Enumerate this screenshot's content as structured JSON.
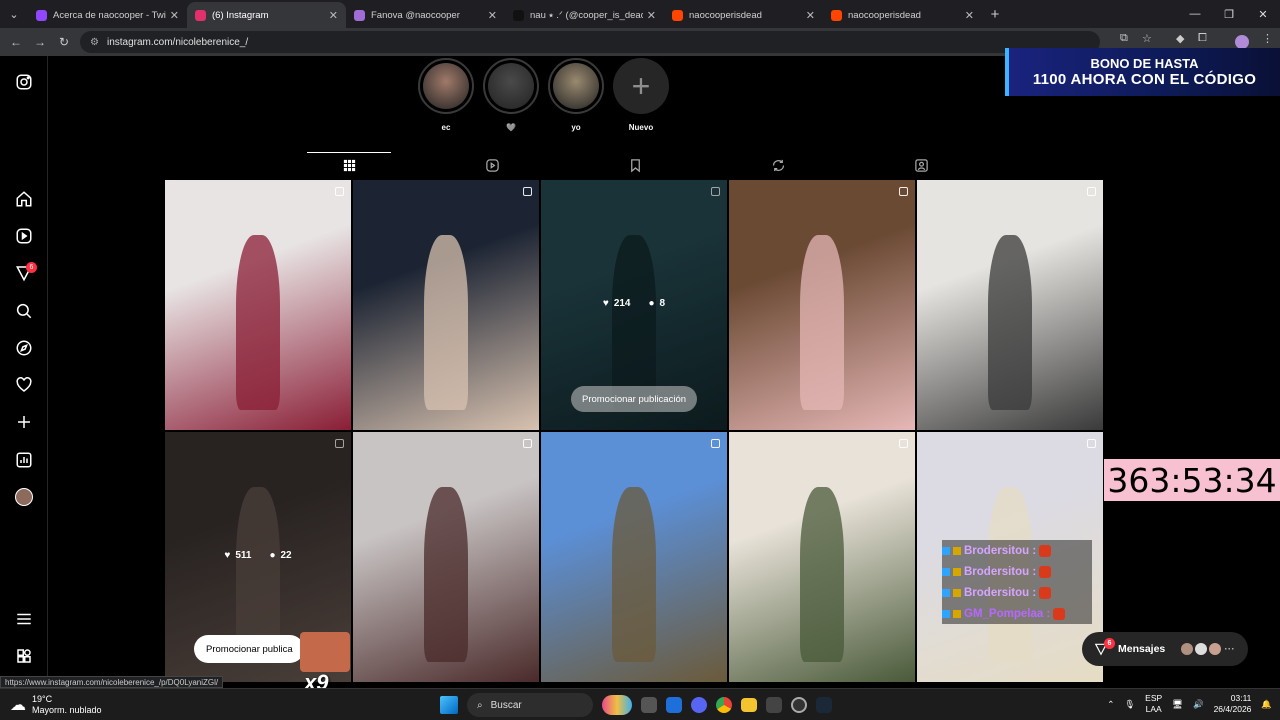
{
  "browser": {
    "tabs": [
      {
        "title": "Acerca de naocooper - Twitch",
        "color": "#9146ff"
      },
      {
        "title": "(6) Instagram",
        "color": "#e1306c",
        "active": true
      },
      {
        "title": "Fanova @naocooper",
        "color": "#a06cd5"
      },
      {
        "title": "nau ⭑ .ᐟ (@cooper_is_dead) | T",
        "color": "#111111"
      },
      {
        "title": "naocooperisdead",
        "color": "#ff4500"
      },
      {
        "title": "naocooperisdead",
        "color": "#ff4500"
      }
    ],
    "url": "instagram.com/nicoleberenice_/",
    "status_url": "https://www.instagram.com/nicoleberenice_/p/DQ0LyaniZGl/"
  },
  "stories": [
    {
      "label": "ec",
      "color": "#a07a6a"
    },
    {
      "label": "🩶",
      "color": "#4a4a4a"
    },
    {
      "label": "yo",
      "color": "#9a8a70"
    },
    {
      "label": "Nuevo",
      "new": true
    }
  ],
  "posts": [
    {
      "color1": "#e8e4e4",
      "color2": "#8a1e36"
    },
    {
      "color1": "#1c2433",
      "color2": "#d8c2b0"
    },
    {
      "color1": "#254a52",
      "color2": "#12262a",
      "hover": true,
      "likes": "214",
      "comments": "8",
      "promo": "Promocionar publicación"
    },
    {
      "color1": "#6b4a34",
      "color2": "#e6b7b6"
    },
    {
      "color1": "#e6e4e0",
      "color2": "#3a3a3a"
    },
    {
      "color1": "#3a3230",
      "color2": "#6a5a52",
      "hover": true,
      "likes": "511",
      "comments": "22"
    },
    {
      "color1": "#c9c4c4",
      "color2": "#4a2a2a"
    },
    {
      "color1": "#5b8fd6",
      "color2": "#6b5a3a"
    },
    {
      "color1": "#e8e2d8",
      "color2": "#4a5a3a"
    },
    {
      "color1": "#dcdbe4",
      "color2": "#e6dcc4"
    }
  ],
  "promo_popup": "Promocionar publica",
  "overlay": {
    "bono_line1": "BONO DE HASTA",
    "bono_line2": "1100 AHORA CON EL CÓDIGO",
    "timer": "363:53:34",
    "chat": [
      {
        "user": "Brodersitou :"
      },
      {
        "user": "Brodersitou :"
      },
      {
        "user": "Brodersitou :"
      },
      {
        "user": "GM_Pompelaa :"
      }
    ],
    "x9": "x9"
  },
  "messages": {
    "label": "Mensajes",
    "badge": "6"
  },
  "sidebar": {
    "notif_badge": "6"
  },
  "taskbar": {
    "temp": "19°C",
    "weather": "Mayorm. nublado",
    "search": "Buscar",
    "lang1": "ESP",
    "lang2": "LAA",
    "time": "03:11",
    "date": "26/4/2026"
  }
}
